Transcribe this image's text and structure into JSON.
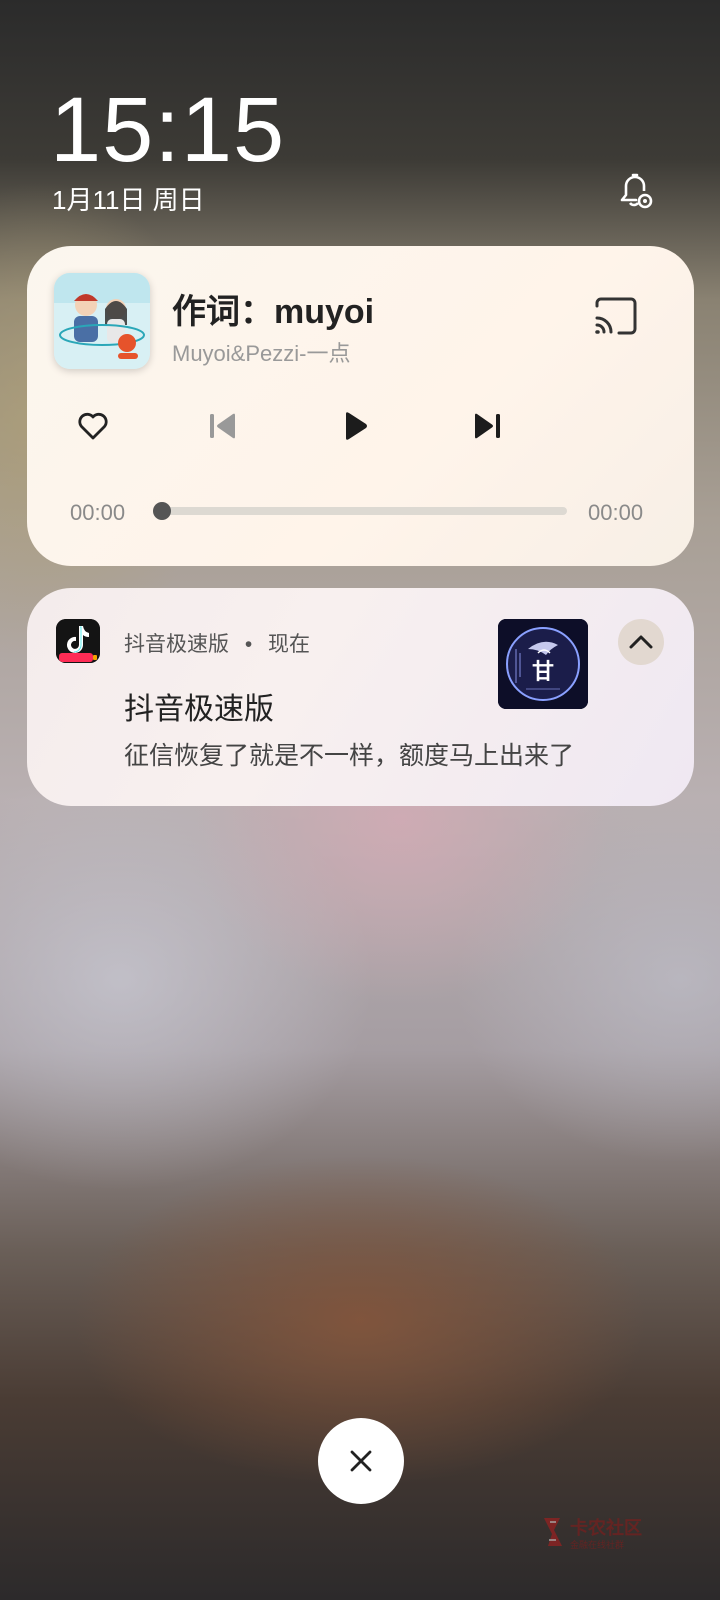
{
  "lockscreen": {
    "time": "15:15",
    "date": "1月11日 周日"
  },
  "media": {
    "title": "作词：muyoi",
    "artist": "Muyoi&Pezzi-一点",
    "elapsed": "00:00",
    "duration": "00:00",
    "progress": 0,
    "icons": [
      "heart-icon",
      "previous-icon",
      "play-icon",
      "next-icon",
      "cast-icon"
    ]
  },
  "notification": {
    "app_name": "抖音极速版",
    "separator": "•",
    "when": "现在",
    "title": "抖音极速版",
    "body": "征信恢复了就是不一样，额度马上出来了",
    "thumb_glyph": "甘"
  },
  "colors": {
    "accent": "#222222",
    "progress_track": "#ddd9d2",
    "progress_thumb": "#555555"
  }
}
